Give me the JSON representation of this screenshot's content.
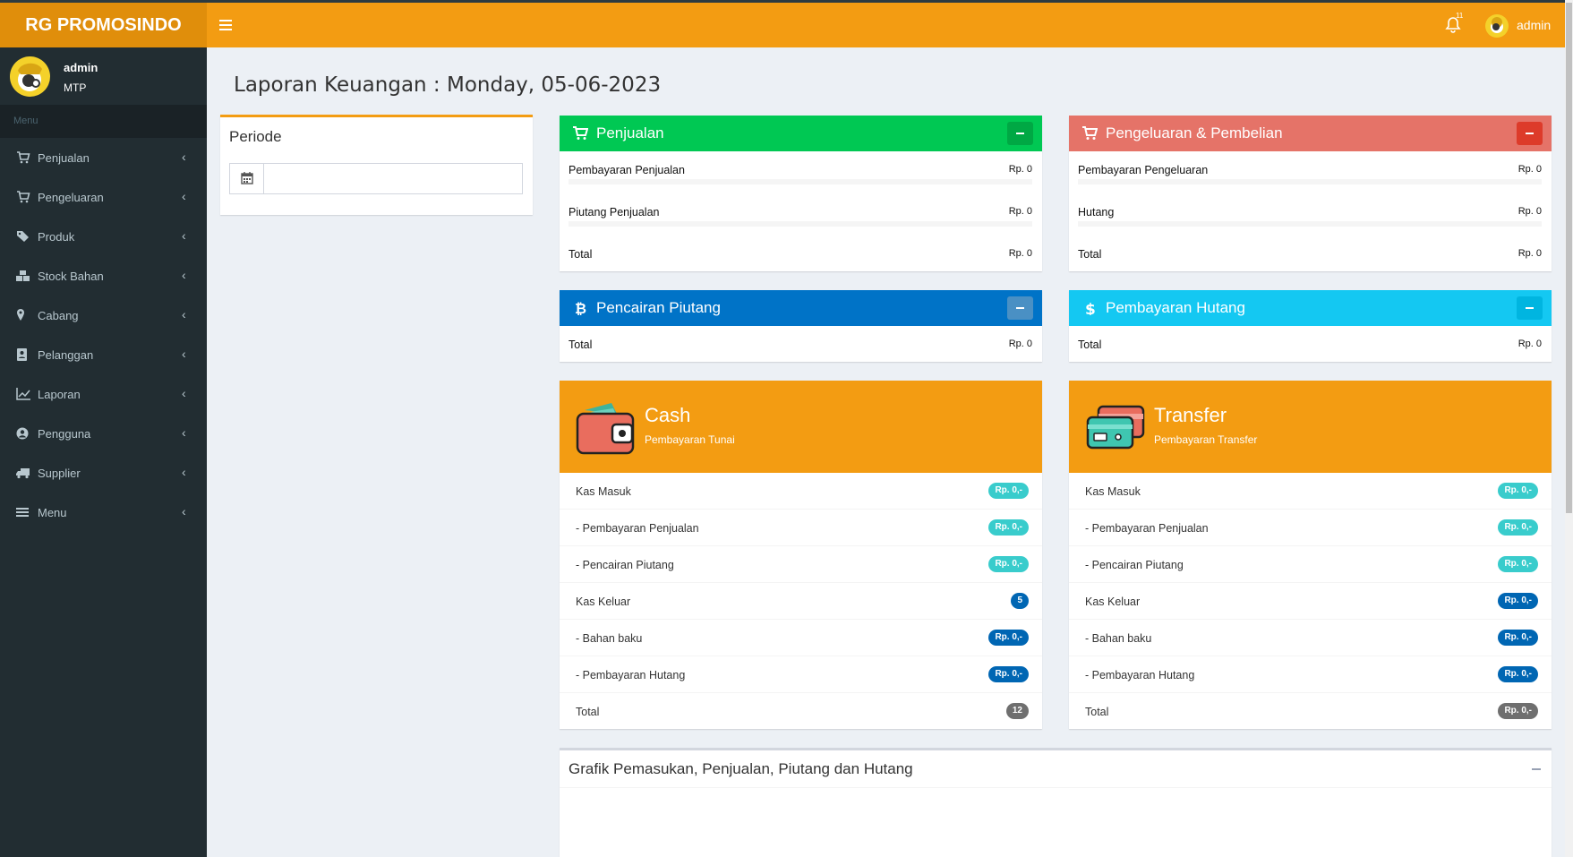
{
  "header": {
    "brand": "RG PROMOSINDO",
    "notif_count": "11",
    "user": "admin"
  },
  "sidebar": {
    "user_name": "admin",
    "user_role": "MTP",
    "menu_header": "Menu",
    "items": [
      {
        "label": "Penjualan",
        "icon": "cart-icon"
      },
      {
        "label": "Pengeluaran",
        "icon": "cart-icon"
      },
      {
        "label": "Produk",
        "icon": "tags-icon"
      },
      {
        "label": "Stock Bahan",
        "icon": "cubes-icon"
      },
      {
        "label": "Cabang",
        "icon": "map-marker-icon"
      },
      {
        "label": "Pelanggan",
        "icon": "contact-icon"
      },
      {
        "label": "Laporan",
        "icon": "line-chart-icon"
      },
      {
        "label": "Pengguna",
        "icon": "user-circle-icon"
      },
      {
        "label": "Supplier",
        "icon": "truck-icon"
      },
      {
        "label": "Menu",
        "icon": "bars-icon"
      }
    ]
  },
  "page_title": "Laporan Keuangan : Monday, 05-06-2023",
  "periode": {
    "title": "Periode",
    "value": ""
  },
  "penjualan": {
    "title": "Penjualan",
    "color": "#00c853",
    "rows": [
      {
        "label": "Pembayaran Penjualan",
        "value": "Rp. 0"
      },
      {
        "label": "Piutang Penjualan",
        "value": "Rp. 0"
      },
      {
        "label": "Total",
        "value": "Rp. 0"
      }
    ]
  },
  "pengeluaran": {
    "title": "Pengeluaran & Pembelian",
    "color": "#e57368",
    "rows": [
      {
        "label": "Pembayaran Pengeluaran",
        "value": "Rp. 0"
      },
      {
        "label": "Hutang",
        "value": "Rp. 0"
      },
      {
        "label": "Total",
        "value": "Rp. 0"
      }
    ]
  },
  "pencairan": {
    "title": "Pencairan Piutang",
    "color": "#0073c7",
    "total_label": "Total",
    "total_value": "Rp. 0"
  },
  "pembayaran_hutang": {
    "title": "Pembayaran Hutang",
    "color": "#14c8f2",
    "total_label": "Total",
    "total_value": "Rp. 0"
  },
  "cash": {
    "title": "Cash",
    "subtitle": "Pembayaran Tunai",
    "rows": [
      {
        "label": "Kas Masuk",
        "badge": "Rp. 0,-",
        "color": "#39cccc"
      },
      {
        "label": "- Pembayaran Penjualan",
        "badge": "Rp. 0,-",
        "color": "#39cccc"
      },
      {
        "label": "- Pencairan Piutang",
        "badge": "Rp. 0,-",
        "color": "#39cccc"
      },
      {
        "label": "Kas Keluar",
        "badge": "5",
        "color": "#0066b3"
      },
      {
        "label": "- Bahan baku",
        "badge": "Rp. 0,-",
        "color": "#0066b3"
      },
      {
        "label": "- Pembayaran Hutang",
        "badge": "Rp. 0,-",
        "color": "#0066b3"
      },
      {
        "label": "Total",
        "badge": "12",
        "color": "#6f6f6f"
      }
    ]
  },
  "transfer": {
    "title": "Transfer",
    "subtitle": "Pembayaran Transfer",
    "rows": [
      {
        "label": "Kas Masuk",
        "badge": "Rp. 0,-",
        "color": "#39cccc"
      },
      {
        "label": "- Pembayaran Penjualan",
        "badge": "Rp. 0,-",
        "color": "#39cccc"
      },
      {
        "label": "- Pencairan Piutang",
        "badge": "Rp. 0,-",
        "color": "#39cccc"
      },
      {
        "label": "Kas Keluar",
        "badge": "Rp. 0,-",
        "color": "#0066b3"
      },
      {
        "label": "- Bahan baku",
        "badge": "Rp. 0,-",
        "color": "#0066b3"
      },
      {
        "label": "- Pembayaran Hutang",
        "badge": "Rp. 0,-",
        "color": "#0066b3"
      },
      {
        "label": "Total",
        "badge": "Rp. 0,-",
        "color": "#6f6f6f"
      }
    ]
  },
  "graph": {
    "title": "Grafik Pemasukan, Penjualan, Piutang dan Hutang"
  }
}
